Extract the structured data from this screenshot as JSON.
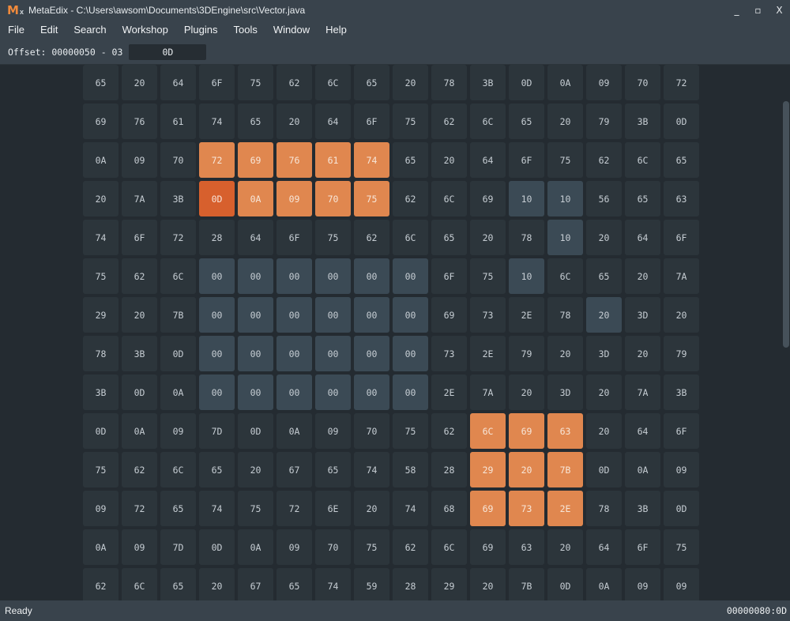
{
  "window": {
    "title": "MetaEdix - C:\\Users\\awsom\\Documents\\3DEngine\\src\\Vector.java",
    "logo_text": "M",
    "logo_sub": "x",
    "minimize_label": "_",
    "maximize_label": "▫",
    "close_label": "X"
  },
  "menu": {
    "items": [
      {
        "label": "File"
      },
      {
        "label": "Edit"
      },
      {
        "label": "Search"
      },
      {
        "label": "Workshop"
      },
      {
        "label": "Plugins"
      },
      {
        "label": "Tools"
      },
      {
        "label": "Window"
      },
      {
        "label": "Help"
      }
    ]
  },
  "offset_bar": {
    "label": "Offset: 00000050 - 03",
    "value": "0D"
  },
  "hex": {
    "rows": [
      [
        "65",
        "20",
        "64",
        "6F",
        "75",
        "62",
        "6C",
        "65",
        "20",
        "78",
        "3B",
        "0D",
        "0A",
        "09",
        "70",
        "72"
      ],
      [
        "69",
        "76",
        "61",
        "74",
        "65",
        "20",
        "64",
        "6F",
        "75",
        "62",
        "6C",
        "65",
        "20",
        "79",
        "3B",
        "0D"
      ],
      [
        "0A",
        "09",
        "70",
        "72",
        "69",
        "76",
        "61",
        "74",
        "65",
        "20",
        "64",
        "6F",
        "75",
        "62",
        "6C",
        "65"
      ],
      [
        "20",
        "7A",
        "3B",
        "0D",
        "0A",
        "09",
        "70",
        "75",
        "62",
        "6C",
        "69",
        "10",
        "10",
        "56",
        "65",
        "63"
      ],
      [
        "74",
        "6F",
        "72",
        "28",
        "64",
        "6F",
        "75",
        "62",
        "6C",
        "65",
        "20",
        "78",
        "10",
        "20",
        "64",
        "6F"
      ],
      [
        "75",
        "62",
        "6C",
        "00",
        "00",
        "00",
        "00",
        "00",
        "00",
        "6F",
        "75",
        "10",
        "6C",
        "65",
        "20",
        "7A"
      ],
      [
        "29",
        "20",
        "7B",
        "00",
        "00",
        "00",
        "00",
        "00",
        "00",
        "69",
        "73",
        "2E",
        "78",
        "20",
        "3D",
        "20"
      ],
      [
        "78",
        "3B",
        "0D",
        "00",
        "00",
        "00",
        "00",
        "00",
        "00",
        "73",
        "2E",
        "79",
        "20",
        "3D",
        "20",
        "79"
      ],
      [
        "3B",
        "0D",
        "0A",
        "00",
        "00",
        "00",
        "00",
        "00",
        "00",
        "2E",
        "7A",
        "20",
        "3D",
        "20",
        "7A",
        "3B"
      ],
      [
        "0D",
        "0A",
        "09",
        "7D",
        "0D",
        "0A",
        "09",
        "70",
        "75",
        "62",
        "6C",
        "69",
        "63",
        "20",
        "64",
        "6F"
      ],
      [
        "75",
        "62",
        "6C",
        "65",
        "20",
        "67",
        "65",
        "74",
        "58",
        "28",
        "29",
        "20",
        "7B",
        "0D",
        "0A",
        "09"
      ],
      [
        "09",
        "72",
        "65",
        "74",
        "75",
        "72",
        "6E",
        "20",
        "74",
        "68",
        "69",
        "73",
        "2E",
        "78",
        "3B",
        "0D"
      ],
      [
        "0A",
        "09",
        "7D",
        "0D",
        "0A",
        "09",
        "70",
        "75",
        "62",
        "6C",
        "69",
        "63",
        "20",
        "64",
        "6F",
        "75"
      ],
      [
        "62",
        "6C",
        "65",
        "20",
        "67",
        "65",
        "74",
        "59",
        "28",
        "29",
        "20",
        "7B",
        "0D",
        "0A",
        "09",
        "09"
      ]
    ],
    "cursor": [
      3,
      3
    ],
    "orange_cells": [
      [
        2,
        3
      ],
      [
        2,
        4
      ],
      [
        2,
        5
      ],
      [
        2,
        6
      ],
      [
        2,
        7
      ],
      [
        3,
        4
      ],
      [
        3,
        5
      ],
      [
        3,
        6
      ],
      [
        3,
        7
      ],
      [
        9,
        10
      ],
      [
        9,
        11
      ],
      [
        9,
        12
      ],
      [
        10,
        10
      ],
      [
        10,
        11
      ],
      [
        10,
        12
      ],
      [
        11,
        10
      ],
      [
        11,
        11
      ],
      [
        11,
        12
      ]
    ],
    "blue_cells": [
      [
        3,
        11
      ],
      [
        3,
        12
      ],
      [
        4,
        12
      ],
      [
        5,
        11
      ],
      [
        6,
        13
      ]
    ],
    "colors": {
      "cell": "#2c353b",
      "zero": "#3b4a55",
      "orange": "#e0874f",
      "cursor": "#d7602d",
      "chrome": "#39434c"
    }
  },
  "status": {
    "left": "Ready",
    "right": "00000080:0D"
  }
}
